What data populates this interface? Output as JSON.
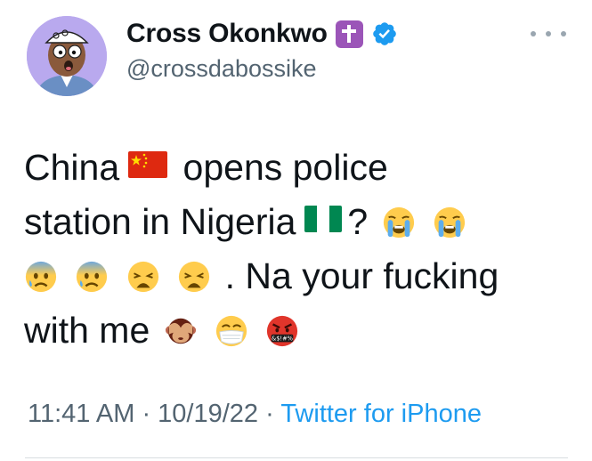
{
  "user": {
    "name": "Cross Okonkwo",
    "handle": "@crossdabossike",
    "name_emoji": "latin-cross-emoji",
    "verified": true,
    "avatar": "cartoon-avatar"
  },
  "tweet": {
    "text_parts": {
      "china": "China",
      "opens": "opens police",
      "station": "station in Nigeria",
      "question": "?",
      "dot": ". Na your fucking",
      "with": "with me"
    },
    "emojis": [
      "flag-china",
      "flag-nigeria",
      "loudly-crying-face",
      "loudly-crying-face",
      "anxious-face-with-sweat",
      "anxious-face-with-sweat",
      "weary-face",
      "weary-face",
      "see-no-evil-monkey",
      "face-with-medical-mask",
      "face-with-symbols-on-mouth"
    ],
    "symbols_on_mouth_text": "&$!#%"
  },
  "meta": {
    "time": "11:41 AM",
    "sep1": " · ",
    "date": "10/19/22",
    "sep2": " · ",
    "source": "Twitter for iPhone"
  },
  "colors": {
    "text": "#0f1419",
    "secondary": "#536471",
    "link": "#1d9bf0",
    "verified": "#1d9bf0",
    "avatar_bg": "#b9a9ee",
    "cross_bg": "#9b55b8"
  }
}
